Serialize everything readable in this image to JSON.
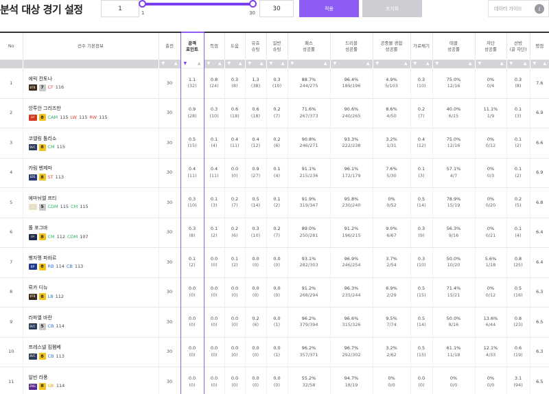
{
  "header": {
    "title": "분석 대상 경기 설정",
    "min_value": "1",
    "max_value": "30",
    "slider_min_label": "1",
    "slider_max_label": "30",
    "apply_label": "적용",
    "reset_label": "초기화",
    "guide_label": "데이터 가이드",
    "guide_icon": "info-icon",
    "accent_color": "#8c5cf5"
  },
  "columns": [
    {
      "key": "no",
      "label": "No",
      "sortable": false
    },
    {
      "key": "player",
      "label": "선수 기본정보",
      "sortable": false
    },
    {
      "key": "games",
      "label": "출전",
      "sortable": true
    },
    {
      "key": "attack_points",
      "label": "공격\n포인트",
      "sortable": true,
      "active_sort": "desc"
    },
    {
      "key": "goals",
      "label": "득점",
      "sortable": true
    },
    {
      "key": "assists",
      "label": "도움",
      "sortable": true
    },
    {
      "key": "eff_shots",
      "label": "유효\n슈팅",
      "sortable": true
    },
    {
      "key": "shots",
      "label": "일반\n슈팅",
      "sortable": true
    },
    {
      "key": "pass",
      "label": "패스\n성공률",
      "sortable": true
    },
    {
      "key": "dribble",
      "label": "드리블\n성공률",
      "sortable": true
    },
    {
      "key": "aerial",
      "label": "공중볼 경합\n성공률",
      "sortable": true
    },
    {
      "key": "intercept",
      "label": "가로채기",
      "sortable": true
    },
    {
      "key": "tackle",
      "label": "태클\n성공률",
      "sortable": true
    },
    {
      "key": "block",
      "label": "차단\n성공률",
      "sortable": true
    },
    {
      "key": "saves",
      "label": "선방\n(골 차단)",
      "sortable": true
    },
    {
      "key": "rating",
      "label": "평점",
      "sortable": true
    }
  ],
  "rows": [
    {
      "no": "1",
      "name": "에릭 칸토나",
      "team": "BTB",
      "team_color": "#3a2a1a",
      "grade": "7",
      "grade_color": "#c9c9c9",
      "positions": [
        {
          "pos": "CF",
          "ovr": "116",
          "cls": "pos-fw"
        }
      ],
      "games": "30",
      "attack_points": [
        "1.1",
        "(32)"
      ],
      "goals": [
        "0.8",
        "(24)"
      ],
      "assists": [
        "0.3",
        "(8)"
      ],
      "eff_shots": [
        "1.3",
        "(38)"
      ],
      "shots": [
        "0.3",
        "(10)"
      ],
      "pass": [
        "88.7%",
        "244/275"
      ],
      "dribble": [
        "96.4%",
        "189/196"
      ],
      "aerial": [
        "4.9%",
        "5/103"
      ],
      "intercept": [
        "0.3",
        "(10)"
      ],
      "tackle": [
        "75.0%",
        "12/16"
      ],
      "block": [
        "0%",
        "0/4"
      ],
      "saves": [
        "0.3",
        "(8)"
      ],
      "rating": "7.6"
    },
    {
      "no": "2",
      "name": "앙투안 그리즈만",
      "team": "LH",
      "team_color": "#d23a1f",
      "grade": "8",
      "grade_color": "#f2c318",
      "positions": [
        {
          "pos": "CAM",
          "ovr": "115",
          "cls": "pos-mf"
        },
        {
          "pos": "LW",
          "ovr": "115",
          "cls": "pos-fw"
        },
        {
          "pos": "RW",
          "ovr": "115",
          "cls": "pos-fw"
        }
      ],
      "games": "30",
      "attack_points": [
        "0.9",
        "(28)"
      ],
      "goals": [
        "0.3",
        "(10)"
      ],
      "assists": [
        "0.6",
        "(18)"
      ],
      "eff_shots": [
        "0.6",
        "(18)"
      ],
      "shots": [
        "0.2",
        "(7)"
      ],
      "pass": [
        "71.6%",
        "267/373"
      ],
      "dribble": [
        "90.6%",
        "240/265"
      ],
      "aerial": [
        "8.6%",
        "4/50"
      ],
      "intercept": [
        "0.2",
        "(7)"
      ],
      "tackle": [
        "40.0%",
        "6/15"
      ],
      "block": [
        "11.1%",
        "1/9"
      ],
      "saves": [
        "0.1",
        "(3)"
      ],
      "rating": "6.9"
    },
    {
      "no": "3",
      "name": "코엘링 톨리소",
      "team": "BVC",
      "team_color": "#2b3a55",
      "grade": "8",
      "grade_color": "#f2c318",
      "positions": [
        {
          "pos": "CM",
          "ovr": "115",
          "cls": "pos-mf"
        }
      ],
      "games": "30",
      "attack_points": [
        "0.5",
        "(15)"
      ],
      "goals": [
        "0.1",
        "(4)"
      ],
      "assists": [
        "0.4",
        "(11)"
      ],
      "eff_shots": [
        "0.4",
        "(12)"
      ],
      "shots": [
        "0.2",
        "(6)"
      ],
      "pass": [
        "90.8%",
        "246/271"
      ],
      "dribble": [
        "93.3%",
        "222/238"
      ],
      "aerial": [
        "3.2%",
        "1/31"
      ],
      "intercept": [
        "0.4",
        "(12)"
      ],
      "tackle": [
        "75.0%",
        "12/16"
      ],
      "block": [
        "0%",
        "0/12"
      ],
      "saves": [
        "0.1",
        "(2)"
      ],
      "rating": "6.6"
    },
    {
      "no": "4",
      "name": "카림 벤제마",
      "team": "EBS",
      "team_color": "#2a3a6b",
      "grade": "8",
      "grade_color": "#f2c318",
      "positions": [
        {
          "pos": "ST",
          "ovr": "113",
          "cls": "pos-fw"
        }
      ],
      "games": "30",
      "attack_points": [
        "0.4",
        "(11)"
      ],
      "goals": [
        "0.4",
        "(11)"
      ],
      "assists": [
        "0.0",
        "(0)"
      ],
      "eff_shots": [
        "0.9",
        "(27)"
      ],
      "shots": [
        "0.1",
        "(4)"
      ],
      "pass": [
        "91.1%",
        "215/236"
      ],
      "dribble": [
        "96.1%",
        "172/179"
      ],
      "aerial": [
        "7.6%",
        "5/30"
      ],
      "intercept": [
        "0.1",
        "(3)"
      ],
      "tackle": [
        "57.1%",
        "4/7"
      ],
      "block": [
        "0%",
        "0/3"
      ],
      "saves": [
        "0.1",
        "(2)"
      ],
      "rating": "6.9"
    },
    {
      "no": "5",
      "name": "에마뉘엘 프티",
      "team": "",
      "team_color": "#e8e0c8",
      "grade": "5",
      "grade_color": "#c9c9c9",
      "positions": [
        {
          "pos": "CDM",
          "ovr": "115",
          "cls": "pos-mf"
        },
        {
          "pos": "CM",
          "ovr": "115",
          "cls": "pos-mf"
        }
      ],
      "games": "30",
      "attack_points": [
        "0.3",
        "(10)"
      ],
      "goals": [
        "0.1",
        "(3)"
      ],
      "assists": [
        "0.2",
        "(7)"
      ],
      "eff_shots": [
        "0.5",
        "(14)"
      ],
      "shots": [
        "0.1",
        "(2)"
      ],
      "pass": [
        "91.9%",
        "319/347"
      ],
      "dribble": [
        "95.8%",
        "230/240"
      ],
      "aerial": [
        "0%",
        "0/52"
      ],
      "intercept": [
        "0.5",
        "(14)"
      ],
      "tackle": [
        "78.9%",
        "15/19"
      ],
      "block": [
        "0%",
        "0/20"
      ],
      "saves": [
        "0.2",
        "(5)"
      ],
      "rating": "6.8"
    },
    {
      "no": "6",
      "name": "폴 포그바",
      "team": "LH",
      "team_color": "#1f2a44",
      "grade": "8",
      "grade_color": "#f2c318",
      "positions": [
        {
          "pos": "CM",
          "ovr": "112",
          "cls": "pos-mf"
        },
        {
          "pos": "CDM",
          "ovr": "107",
          "cls": "pos-mf"
        }
      ],
      "games": "30",
      "attack_points": [
        "0.3",
        "(8)"
      ],
      "goals": [
        "0.1",
        "(2)"
      ],
      "assists": [
        "0.2",
        "(6)"
      ],
      "eff_shots": [
        "0.3",
        "(10)"
      ],
      "shots": [
        "0.2",
        "(7)"
      ],
      "pass": [
        "89.0%",
        "250/281"
      ],
      "dribble": [
        "91.2%",
        "196/215"
      ],
      "aerial": [
        "9.0%",
        "6/67"
      ],
      "intercept": [
        "0.3",
        "(9)"
      ],
      "tackle": [
        "56.3%",
        "9/16"
      ],
      "block": [
        "0%",
        "0/21"
      ],
      "saves": [
        "0.1",
        "(4)"
      ],
      "rating": "6.4"
    },
    {
      "no": "7",
      "name": "벵자멩 파바르",
      "team": "BP",
      "team_color": "#1e3a8a",
      "grade": "8",
      "grade_color": "#f2c318",
      "positions": [
        {
          "pos": "RB",
          "ovr": "114",
          "cls": "pos-df"
        },
        {
          "pos": "CB",
          "ovr": "113",
          "cls": "pos-df"
        }
      ],
      "games": "30",
      "attack_points": [
        "0.1",
        "(2)"
      ],
      "goals": [
        "0.0",
        "(0)"
      ],
      "assists": [
        "0.1",
        "(2)"
      ],
      "eff_shots": [
        "0.0",
        "(0)"
      ],
      "shots": [
        "0.0",
        "(0)"
      ],
      "pass": [
        "93.1%",
        "282/303"
      ],
      "dribble": [
        "96.9%",
        "246/254"
      ],
      "aerial": [
        "3.7%",
        "2/54"
      ],
      "intercept": [
        "0.3",
        "(10)"
      ],
      "tackle": [
        "50.0%",
        "10/20"
      ],
      "block": [
        "5.6%",
        "1/18"
      ],
      "saves": [
        "0.8",
        "(25)"
      ],
      "rating": "6.4"
    },
    {
      "no": "8",
      "name": "뤼카 디뉴",
      "team": "BTB",
      "team_color": "#3a2a1a",
      "grade": "8",
      "grade_color": "#f2c318",
      "positions": [
        {
          "pos": "LB",
          "ovr": "112",
          "cls": "pos-df"
        }
      ],
      "games": "30",
      "attack_points": [
        "0.0",
        "(0)"
      ],
      "goals": [
        "0.0",
        "(0)"
      ],
      "assists": [
        "0.0",
        "(0)"
      ],
      "eff_shots": [
        "0.0",
        "(0)"
      ],
      "shots": [
        "0.0",
        "(0)"
      ],
      "pass": [
        "91.2%",
        "268/294"
      ],
      "dribble": [
        "96.3%",
        "235/244"
      ],
      "aerial": [
        "6.9%",
        "2/29"
      ],
      "intercept": [
        "0.5",
        "(15)"
      ],
      "tackle": [
        "71.4%",
        "15/21"
      ],
      "block": [
        "0%",
        "0/12"
      ],
      "saves": [
        "0.5",
        "(16)"
      ],
      "rating": "6.3"
    },
    {
      "no": "9",
      "name": "라파엘 바란",
      "team": "BVC",
      "team_color": "#2b3a55",
      "grade": "5",
      "grade_color": "#c9c9c9",
      "positions": [
        {
          "pos": "CB",
          "ovr": "114",
          "cls": "pos-df"
        }
      ],
      "games": "30",
      "attack_points": [
        "0.0",
        "(0)"
      ],
      "goals": [
        "0.0",
        "(0)"
      ],
      "assists": [
        "0.0",
        "(0)"
      ],
      "eff_shots": [
        "0.2",
        "(6)"
      ],
      "shots": [
        "0.0",
        "(1)"
      ],
      "pass": [
        "96.2%",
        "379/394"
      ],
      "dribble": [
        "96.6%",
        "315/326"
      ],
      "aerial": [
        "9.5%",
        "7/74"
      ],
      "intercept": [
        "0.5",
        "(14)"
      ],
      "tackle": [
        "50.0%",
        "8/16"
      ],
      "block": [
        "13.6%",
        "6/44"
      ],
      "saves": [
        "0.8",
        "(23)"
      ],
      "rating": "6.5"
    },
    {
      "no": "10",
      "name": "프레스넬 킴펨베",
      "team": "BVC",
      "team_color": "#2b3a55",
      "grade": "8",
      "grade_color": "#f2c318",
      "positions": [
        {
          "pos": "CB",
          "ovr": "113",
          "cls": "pos-df"
        }
      ],
      "games": "30",
      "attack_points": [
        "0.0",
        "(0)"
      ],
      "goals": [
        "0.0",
        "(0)"
      ],
      "assists": [
        "0.0",
        "(0)"
      ],
      "eff_shots": [
        "0.0",
        "(0)"
      ],
      "shots": [
        "0.0",
        "(1)"
      ],
      "pass": [
        "96.2%",
        "357/371"
      ],
      "dribble": [
        "96.7%",
        "292/302"
      ],
      "aerial": [
        "3.2%",
        "2/62"
      ],
      "intercept": [
        "0.5",
        "(15)"
      ],
      "tackle": [
        "61.1%",
        "11/18"
      ],
      "block": [
        "12.1%",
        "4/33"
      ],
      "saves": [
        "0.6",
        "(19)"
      ],
      "rating": "6.3"
    },
    {
      "no": "11",
      "name": "알빈 라퐁",
      "team": "ZNG",
      "team_color": "#5a2a8a",
      "grade": "8",
      "grade_color": "#f2c318",
      "positions": [
        {
          "pos": "GK",
          "ovr": "114",
          "cls": "pos-gk"
        }
      ],
      "games": "30",
      "attack_points": [
        "0.0",
        "(0)"
      ],
      "goals": [
        "0.0",
        "(0)"
      ],
      "assists": [
        "0.0",
        "(0)"
      ],
      "eff_shots": [
        "0.0",
        "(0)"
      ],
      "shots": [
        "0.0",
        "(0)"
      ],
      "pass": [
        "55.2%",
        "32/58"
      ],
      "dribble": [
        "94.7%",
        "18/19"
      ],
      "aerial": [
        "0%",
        "0/0"
      ],
      "intercept": [
        "0.0",
        "(0)"
      ],
      "tackle": [
        "0%",
        "0/0"
      ],
      "block": [
        "0%",
        "0/0"
      ],
      "saves": [
        "3.1",
        "(94)"
      ],
      "rating": "6.5"
    }
  ]
}
